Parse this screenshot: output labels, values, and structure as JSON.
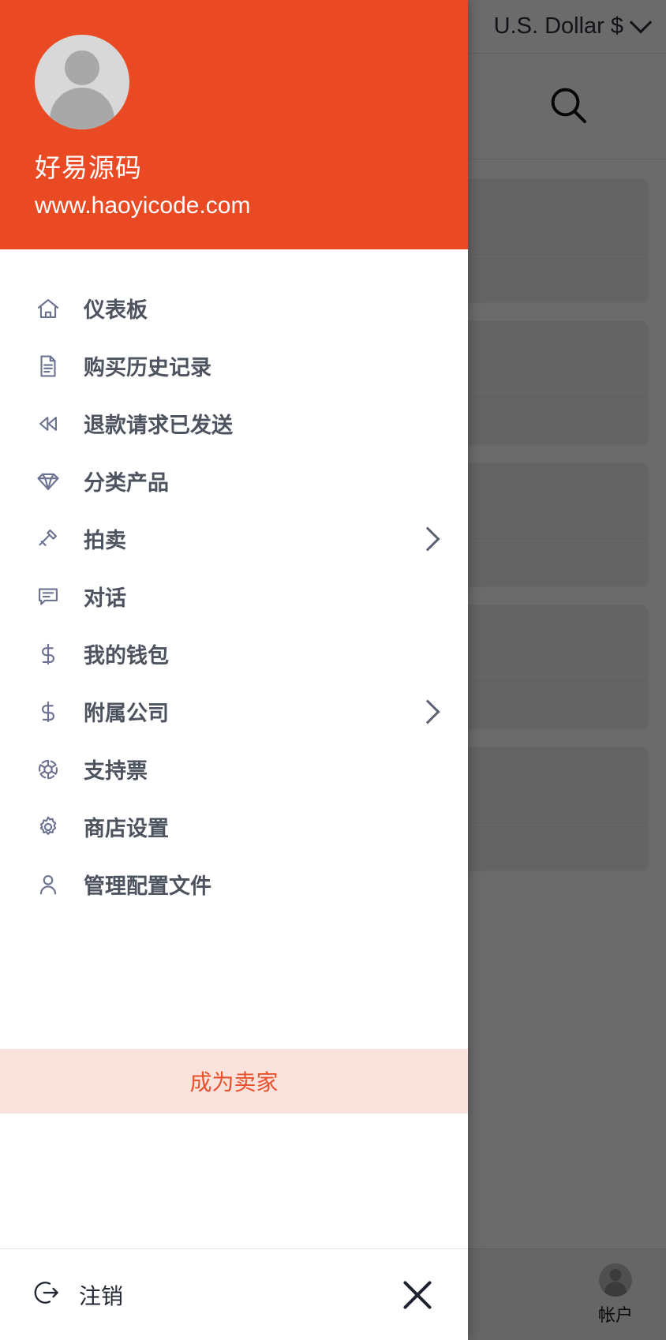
{
  "background": {
    "currency_selector": {
      "label": "U.S. Dollar $",
      "chevron_icon": "chevron-down-icon"
    },
    "search_icon": "search-icon",
    "bottom_tab": {
      "label": "帐户",
      "icon": "account-avatar-icon"
    }
  },
  "drawer": {
    "header": {
      "avatar_icon": "user-avatar-placeholder-icon",
      "user_name": "好易源码",
      "site_url": "www.haoyicode.com",
      "background_color": "#e94a24"
    },
    "menu": [
      {
        "label": "仪表板",
        "icon": "home-icon",
        "has_chevron": false
      },
      {
        "label": "购买历史记录",
        "icon": "document-icon",
        "has_chevron": false
      },
      {
        "label": "退款请求已发送",
        "icon": "rewind-icon",
        "has_chevron": false
      },
      {
        "label": "分类产品",
        "icon": "diamond-icon",
        "has_chevron": false
      },
      {
        "label": "拍卖",
        "icon": "gavel-icon",
        "has_chevron": true
      },
      {
        "label": "对话",
        "icon": "chat-bubble-icon",
        "has_chevron": false
      },
      {
        "label": "我的钱包",
        "icon": "dollar-sign-icon",
        "has_chevron": false
      },
      {
        "label": "附属公司",
        "icon": "dollar-sign-icon",
        "has_chevron": true
      },
      {
        "label": "支持票",
        "icon": "lifebuoy-icon",
        "has_chevron": false
      },
      {
        "label": "商店设置",
        "icon": "gear-icon",
        "has_chevron": false
      },
      {
        "label": "管理配置文件",
        "icon": "user-outline-icon",
        "has_chevron": false
      }
    ],
    "seller_banner": {
      "label": "成为卖家",
      "text_color": "#e8512b",
      "background_color": "#fae3dc"
    },
    "footer": {
      "logout_label": "注销",
      "logout_icon": "logout-icon",
      "close_icon": "close-icon"
    }
  }
}
